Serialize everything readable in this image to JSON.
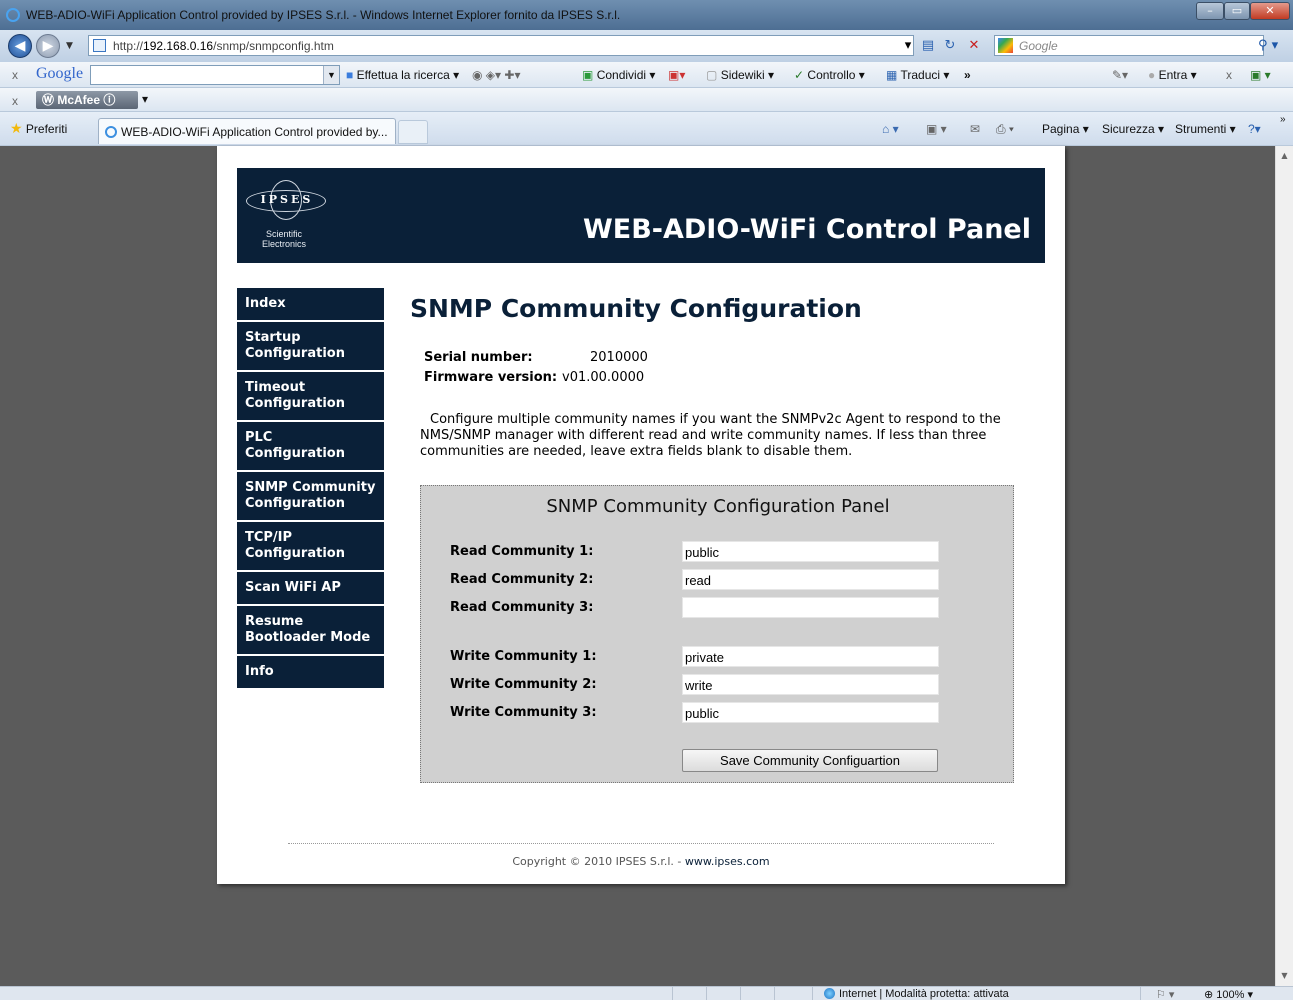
{
  "window": {
    "title": "WEB-ADIO-WiFi Application Control provided by IPSES S.r.l. - Windows Internet Explorer fornito da IPSES S.r.l.",
    "min": "–",
    "max": "▭",
    "close": "✕"
  },
  "address": {
    "url_prefix": "http://",
    "url_host": "192.168.0.16",
    "url_path": "/snmp/snmpconfig.htm",
    "search_placeholder": "Google"
  },
  "google_toolbar": {
    "close": "x",
    "logo": "Google",
    "search_btn": "Effettua la ricerca ▾",
    "share": "Condividi ▾",
    "sidewiki": "Sidewiki ▾",
    "check": "Controllo ▾",
    "translate": "Traduci ▾",
    "more": "»",
    "signin": "Entra ▾"
  },
  "mcafee_toolbar": {
    "close": "x",
    "label": "McAfee"
  },
  "favorites_bar": {
    "favorites": "Preferiti",
    "tab_title": "WEB-ADIO-WiFi Application Control provided by...",
    "cmd_page": "Pagina ▾",
    "cmd_security": "Sicurezza ▾",
    "cmd_tools": "Strumenti ▾",
    "cmd_help": "?▾"
  },
  "header": {
    "logo_brand": "IPSES",
    "logo_sub1": "Scientific",
    "logo_sub2": "Electronics",
    "title": "WEB-ADIO-WiFi Control Panel"
  },
  "menu": {
    "items": [
      "Index",
      "Startup Configuration",
      "Timeout Configuration",
      "PLC Configuration",
      "SNMP Community Configuration",
      "TCP/IP Configuration",
      "Scan WiFi AP",
      "Resume Bootloader Mode",
      "Info"
    ]
  },
  "main": {
    "heading": "SNMP Community Configuration",
    "serial_label": "Serial number:",
    "serial_value": "2010000",
    "firmware_label": "Firmware version:",
    "firmware_value": "v01.00.0000",
    "intro": "Configure multiple community names if you want the SNMPv2c Agent to respond to the NMS/SNMP manager with different read and write community names. If less than three communities are needed, leave extra fields blank to disable them."
  },
  "panel": {
    "title": "SNMP Community Configuration Panel",
    "read": [
      {
        "label": "Read Community 1:",
        "value": "public"
      },
      {
        "label": "Read Community 2:",
        "value": "read"
      },
      {
        "label": "Read Community 3:",
        "value": ""
      }
    ],
    "write": [
      {
        "label": "Write Community 1:",
        "value": "private"
      },
      {
        "label": "Write Community 2:",
        "value": "write"
      },
      {
        "label": "Write Community 3:",
        "value": "public"
      }
    ],
    "save_label": "Save Community Configuartion"
  },
  "footer": {
    "copyright": "Copyright © 2010 IPSES S.r.l. - ",
    "link": "www.ipses.com"
  },
  "statusbar": {
    "zone": "Internet | Modalità protetta: attivata",
    "zoom": "100%"
  }
}
